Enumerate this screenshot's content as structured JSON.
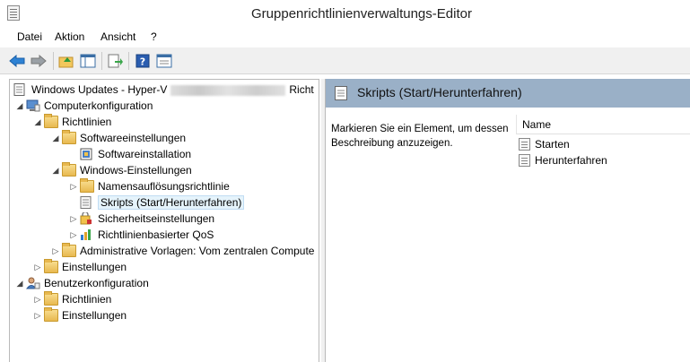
{
  "window": {
    "title": "Gruppenrichtlinienverwaltungs-Editor"
  },
  "menu": [
    "Datei",
    "Aktion",
    "Ansicht",
    "?"
  ],
  "toolbar": [
    "back-arrow-icon",
    "forward-arrow-icon",
    "up-folder-icon",
    "show-hide-tree-icon",
    "export-list-icon",
    "help-icon",
    "properties-icon"
  ],
  "tree": {
    "root": {
      "label": "Windows Updates - Hyper-V",
      "suffix": "Richt"
    },
    "computer_config": "Computerkonfiguration",
    "policies": "Richtlinien",
    "software_settings": "Softwareeinstellungen",
    "software_install": "Softwareinstallation",
    "windows_settings": "Windows-Einstellungen",
    "name_resolution": "Namensauflösungsrichtlinie",
    "scripts": "Skripts (Start/Herunterfahren)",
    "security": "Sicherheitseinstellungen",
    "qos": "Richtlinienbasierter QoS",
    "admin_templates": "Administrative Vorlagen: Vom zentralen Compute",
    "preferences": "Einstellungen",
    "user_config": "Benutzerkonfiguration",
    "user_policies": "Richtlinien",
    "user_preferences": "Einstellungen"
  },
  "details": {
    "title": "Skripts (Start/Herunterfahren)",
    "description": "Markieren Sie ein Element, um dessen Beschreibung anzuzeigen.",
    "column_name": "Name",
    "items": [
      "Starten",
      "Herunterfahren"
    ]
  },
  "colors": {
    "header": "#9ab0c7",
    "selection": "#e5f3fb"
  }
}
